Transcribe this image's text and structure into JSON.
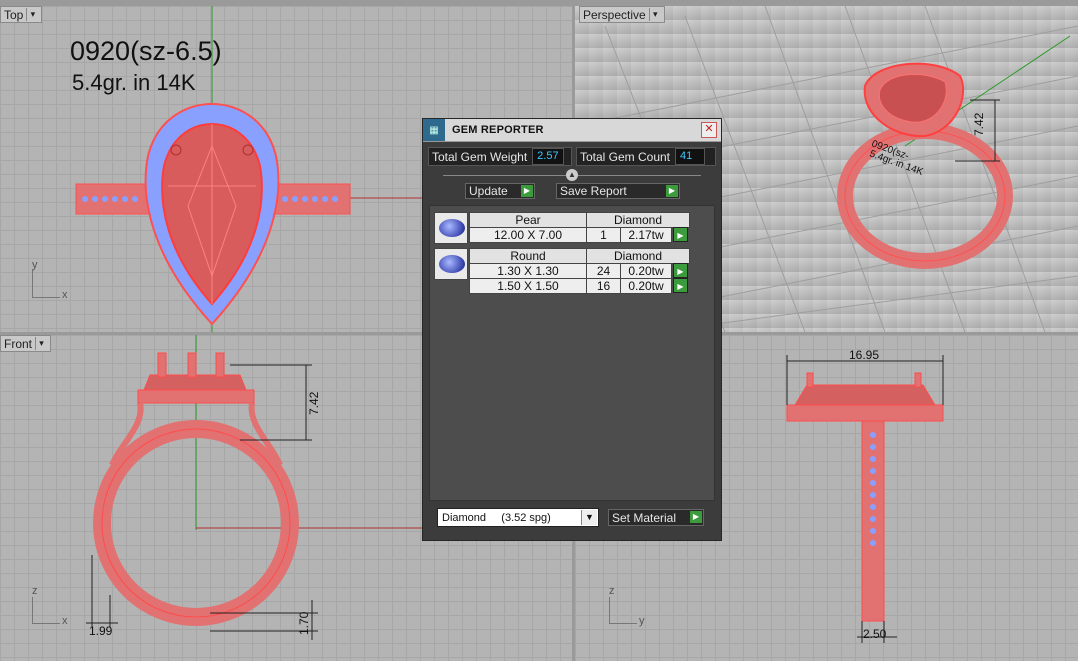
{
  "viewports": {
    "top": {
      "label": "Top",
      "title": "0920(sz-6.5)",
      "subtitle": "5.4gr.  in 14K",
      "axis_x": "x",
      "axis_y": "y"
    },
    "perspective": {
      "label": "Perspective",
      "dim_height": "7.42",
      "ring_text": "0920(sz-",
      "ring_text2": "5.4gr.  in 14K"
    },
    "front": {
      "label": "Front",
      "dim_height": "7.42",
      "dim_shank": "1.99",
      "dim_bottom": "1.70",
      "axis_x": "x",
      "axis_z": "z"
    },
    "right": {
      "label": "",
      "dim_width": "16.95",
      "dim_shank": "2.50",
      "axis_y": "y",
      "axis_z": "z"
    }
  },
  "dialog": {
    "title": "GEM REPORTER",
    "total_weight_label": "Total Gem Weight",
    "total_weight_value": "2.57",
    "total_count_label": "Total Gem Count",
    "total_count_value": "41",
    "update_label": "Update",
    "save_report_label": "Save Report",
    "groups": [
      {
        "shape": "Pear",
        "material": "Diamond",
        "rows": [
          {
            "size": "12.00 X 7.00",
            "count": "1",
            "weight": "2.17tw"
          }
        ]
      },
      {
        "shape": "Round",
        "material": "Diamond",
        "rows": [
          {
            "size": "1.30 X 1.30",
            "count": "24",
            "weight": "0.20tw"
          },
          {
            "size": "1.50 X 1.50",
            "count": "16",
            "weight": "0.20tw"
          }
        ]
      }
    ],
    "material_select": "Diamond     (3.52 spg)",
    "set_material_label": "Set Material"
  },
  "colors": {
    "ring": "#e27272",
    "ring_edge": "#ff4444",
    "gem_blue": "#8aa0ff",
    "accent_green": "#3c9b3c",
    "value_cyan": "#3ec8ff"
  }
}
